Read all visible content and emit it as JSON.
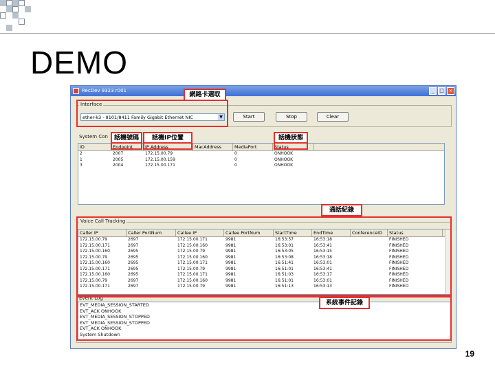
{
  "slide": {
    "title": "DEMO",
    "page_number": "19"
  },
  "window": {
    "title": "RecDev  9323  r001",
    "min_symbol": "_",
    "max_symbol": "□",
    "close_symbol": "×"
  },
  "interface": {
    "label": "Interface",
    "adapter_value": "ether-k3  -  8101/8411 Family Gigabit Ethernet NIC",
    "start_label": "Start",
    "stop_label": "Stop",
    "clear_label": "Clear"
  },
  "system_config": {
    "label": "System Con",
    "columns": [
      "ID",
      "Endpoint",
      "IP Address",
      "MacAddress",
      "MediaPort",
      "Status"
    ],
    "rows": [
      [
        "2",
        "2007",
        "172.15.00.79",
        "",
        "0",
        "ONHOOK"
      ],
      [
        "1",
        "2005",
        "172.15.00.159",
        "",
        "0",
        "ONHOOK"
      ],
      [
        "3",
        "2004",
        "172.15.00.171",
        "",
        "0",
        "ONHOOK"
      ]
    ]
  },
  "voice_call": {
    "label": "Voice Call Tracking",
    "columns": [
      "Caller IP",
      "Caller PortNum",
      "Callee IP",
      "Callee PortNum",
      "StartTime",
      "EndTime",
      "ConferenceID",
      "Status"
    ],
    "rows": [
      [
        "172.15.00.79",
        "2697",
        "172.15.00.171",
        "9981",
        "16:53:57",
        "16:53:18",
        "",
        "FINISHED"
      ],
      [
        "172.15.00.171",
        "2697",
        "172.15.00.160",
        "9981",
        "16:53:01",
        "16:53:41",
        "",
        "FINISHED"
      ],
      [
        "172.15.00.160",
        "2695",
        "172.15.00.79",
        "9981",
        "16:53:05",
        "16:53:15",
        "",
        "FINISHED"
      ],
      [
        "172.15.00.79",
        "2695",
        "172.15.00.160",
        "9981",
        "16:53:08",
        "16:53:18",
        "",
        "FINISHED"
      ],
      [
        "172.15.00.160",
        "2695",
        "172.15.00.171",
        "9981",
        "16:51:41",
        "16:53:01",
        "",
        "FINISHED"
      ],
      [
        "172.15.00.171",
        "2695",
        "172.15.00.79",
        "9981",
        "16:51:01",
        "16:53:41",
        "",
        "FINISHED"
      ],
      [
        "172.15.00.160",
        "2695",
        "172.15.00.171",
        "9981",
        "16:51:03",
        "16:53:17",
        "",
        "FINISHED"
      ],
      [
        "172.15.00.79",
        "2697",
        "172.15.00.160",
        "9981",
        "16:51:01",
        "16:53:01",
        "",
        "FINISHED"
      ],
      [
        "172.15.00.171",
        "2697",
        "172.15.00.79",
        "9981",
        "16:51:13",
        "16:53:13",
        "",
        "FINISHED"
      ]
    ]
  },
  "event_log": {
    "label": "Event Log",
    "lines": [
      "EVT_MEDIA_SESSION_STARTED",
      "EVT_ACK  ONHOOK",
      "EVT_MEDIA_SESSION_STOPPED",
      "EVT_MEDIA_SESSION_STOPPED",
      "EVT_ACK  ONHOOK",
      "System Shutdown"
    ]
  },
  "annotations": {
    "nic_select": "網路卡選取",
    "phone_number": "話機號碼",
    "phone_ip": "話機IP位置",
    "phone_status": "話機狀態",
    "call_record": "通話紀錄",
    "event_record": "系統事件記錄"
  }
}
